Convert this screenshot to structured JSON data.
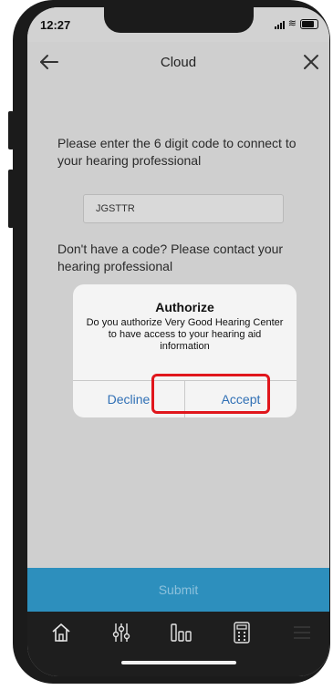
{
  "status_bar": {
    "time": "12:27"
  },
  "nav": {
    "title": "Cloud",
    "back_icon": "arrow-left-icon",
    "close_icon": "close-icon"
  },
  "form": {
    "instruction": "Please enter the 6 digit code to connect to your hearing professional",
    "code_value": "JGSTTR",
    "no_code_text": "Don't have a code? Please contact your hearing professional"
  },
  "dialog": {
    "title": "Authorize",
    "message": "Do you authorize Very Good Hearing Center to have access to your hearing aid information",
    "decline_label": "Decline",
    "accept_label": "Accept"
  },
  "submit": {
    "label": "Submit"
  },
  "tab_bar": {
    "items": [
      {
        "icon": "home-icon"
      },
      {
        "icon": "sliders-icon"
      },
      {
        "icon": "bars-icon"
      },
      {
        "icon": "remote-icon"
      },
      {
        "icon": "menu-icon"
      }
    ]
  },
  "colors": {
    "accent": "#2f6fb5",
    "submit_bg": "#2d8fbd",
    "highlight": "#e0161c",
    "tab_bar_bg": "#1e1e1e",
    "screen_bg": "#cfcfcf"
  }
}
